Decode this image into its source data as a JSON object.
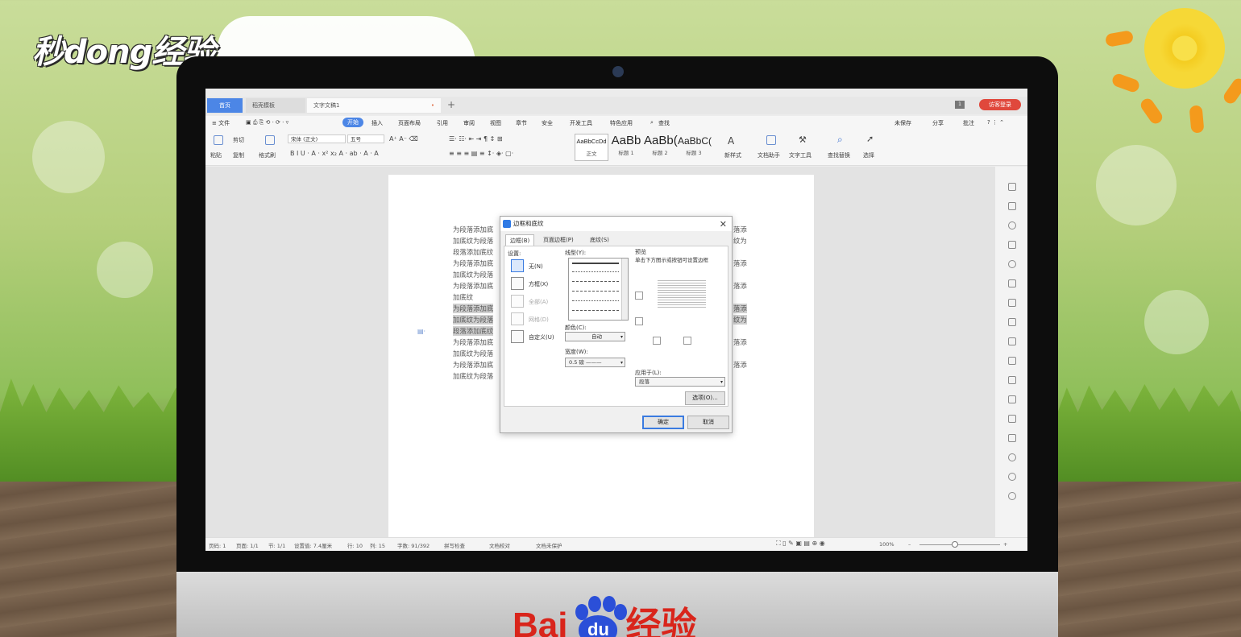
{
  "watermark_top": "秒dong经验",
  "watermark_bottom": {
    "left": "Bai",
    "paw": "du",
    "right": "经验"
  },
  "tabs": {
    "home": "首页",
    "template": "稻壳模板",
    "document": "文字文稿1",
    "document_close": "•",
    "new_tab": "+",
    "badge": "1",
    "login": "访客登录"
  },
  "menu": {
    "file": "≡ 文件",
    "items": [
      "开始",
      "插入",
      "页面布局",
      "引用",
      "审阅",
      "视图",
      "章节",
      "安全",
      "开发工具",
      "特色应用"
    ],
    "search": "查找",
    "right": [
      "未保存",
      "分享",
      "批注"
    ]
  },
  "ribbon": {
    "paste": "粘贴",
    "cut": "剪切",
    "copy": "复制",
    "format_painter": "格式刷",
    "font_name": "宋体 (正文)",
    "font_size": "五号",
    "styles": [
      {
        "preview": "AaBbCcDd",
        "label": "正文"
      },
      {
        "preview": "AaBb",
        "label": "标题 1"
      },
      {
        "preview": "AaBb(",
        "label": "标题 2"
      },
      {
        "preview": "AaBbC(",
        "label": "标题 3"
      }
    ],
    "new_style": "新样式",
    "doc_helper": "文档助手",
    "text_tool": "文字工具",
    "find_replace": "查找替换",
    "select": "选择"
  },
  "document": {
    "lines_left": [
      "为段落添加底",
      "加底纹为段落",
      "段落添加底纹",
      "为段落添加底",
      "加底纹为段落",
      "为段落添加底",
      "加底纹",
      "为段落添加底",
      "加底纹为段落",
      "段落添加底纹",
      "为段落添加底",
      "加底纹为段落",
      "为段落添加底",
      "加底纹为段落"
    ],
    "lines_right": [
      "落添",
      "纹为",
      "落添",
      "落添",
      "落添",
      "纹为",
      "落添",
      "落添"
    ]
  },
  "dialog": {
    "title": "边框和底纹",
    "tabs": [
      "边框(B)",
      "页面边框(P)",
      "底纹(S)"
    ],
    "setting_label": "设置:",
    "settings": [
      "无(N)",
      "方框(X)",
      "全部(A)",
      "网格(D)",
      "自定义(U)"
    ],
    "style_label": "线型(Y):",
    "color_label": "颜色(C):",
    "color_value": "自动",
    "width_label": "宽度(W):",
    "width_value": "0.5  磅 ———",
    "preview_label": "预览",
    "preview_hint": "单击下方图示或按钮可设置边框",
    "apply_label": "应用于(L):",
    "apply_value": "段落",
    "options_button": "选项(O)...",
    "ok": "确定",
    "cancel": "取消"
  },
  "status": {
    "page": "页码: 1",
    "pages": "页面: 1/1",
    "section": "节: 1/1",
    "setting": "设置值: 7.4厘米",
    "row": "行: 10",
    "col": "列: 15",
    "words": "字数: 91/392",
    "spell": "拼写检查",
    "proof": "文档校对",
    "protect": "文档未保护",
    "zoom": "100%"
  }
}
